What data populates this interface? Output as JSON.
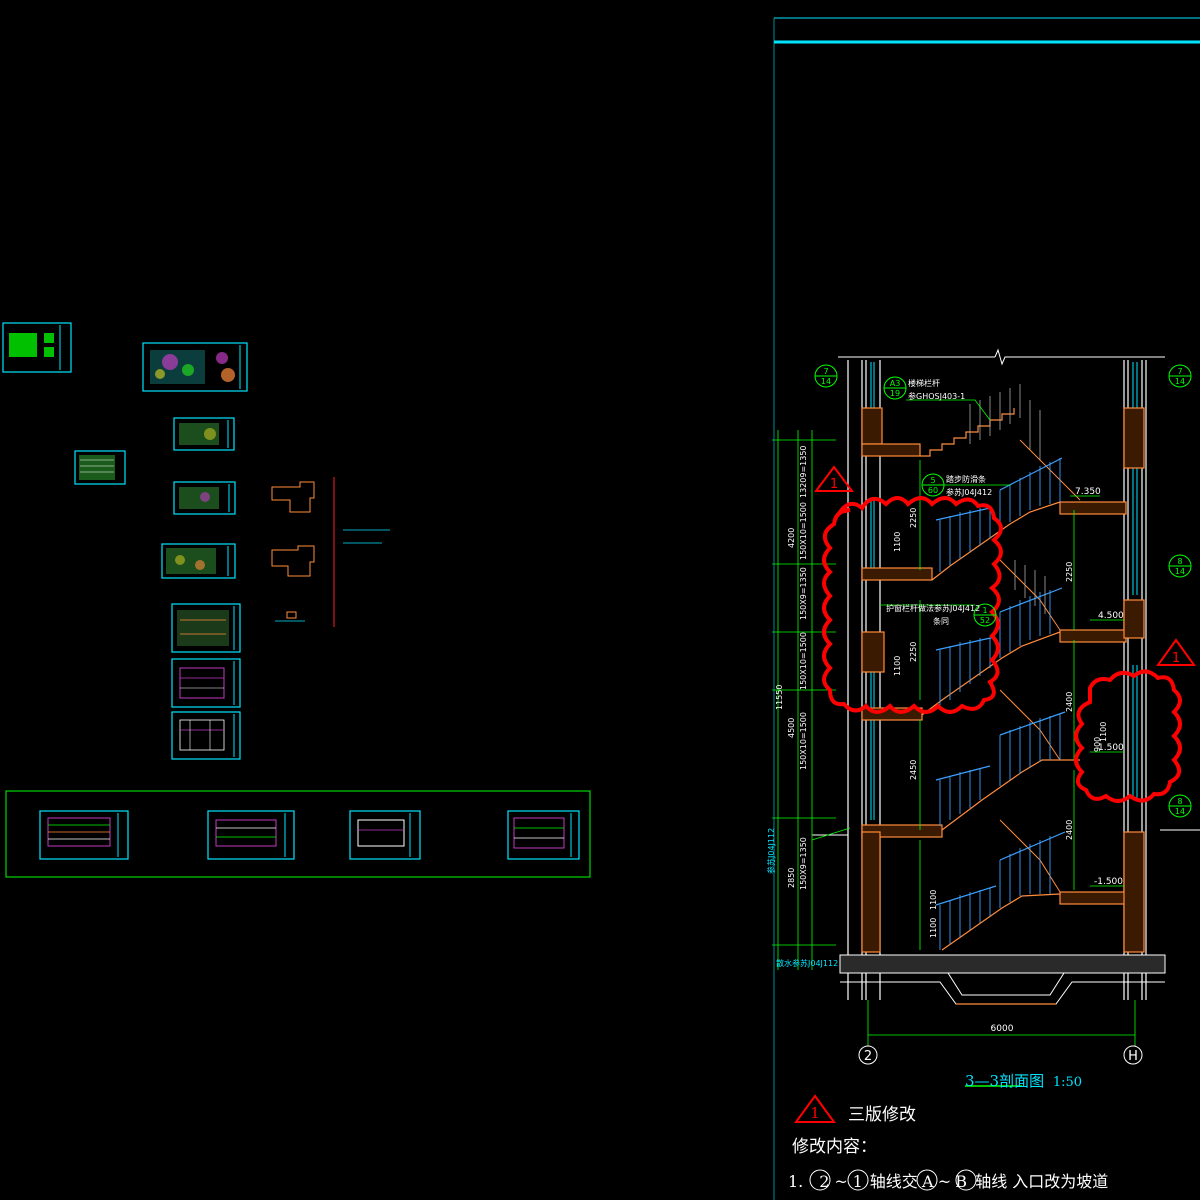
{
  "drawing": {
    "section_title": "3—3剖面图",
    "section_scale": "1:50",
    "axes": {
      "left": "2",
      "right": "H"
    },
    "dimension_bottom": "6000",
    "elevations": [
      "7.350",
      "4.500",
      "1.500",
      "-1.500"
    ],
    "left_dims": [
      "4200",
      "4500",
      "11550",
      "2850",
      "13209=1350",
      "150X10=1500",
      "150X9=1350",
      "150X10=1500",
      "150X10=1500",
      "150X9=1350"
    ],
    "inner_dims": [
      "2250",
      "1100",
      "2250",
      "1100",
      "2450",
      "2400",
      "2400",
      "1100",
      "2250",
      "900",
      "1100"
    ],
    "detail_marks": [
      {
        "num": "7",
        "sheet": "14"
      },
      {
        "num": "7",
        "sheet": "14"
      },
      {
        "num": "8",
        "sheet": "14"
      },
      {
        "num": "8",
        "sheet": "14"
      },
      {
        "num": "5",
        "sheet": "60"
      },
      {
        "num": "A3",
        "sheet": "19"
      },
      {
        "num": "1",
        "sheet": "52"
      }
    ],
    "annotations": [
      "楼梯栏杆",
      "参GHOSJ403-1",
      "踏步防滑条",
      "参苏J04J412",
      "护窗栏杆做法参苏J04J412",
      "条同",
      "参苏J04J112",
      "散水参苏J04J112"
    ],
    "revision_symbol": "1"
  },
  "revision": {
    "symbol": "1",
    "label": "三版修改",
    "content_label": "修改内容：",
    "item_prefix": "1.",
    "item_axis_a": "2",
    "item_tilde1": "~",
    "item_axis_b": "1",
    "item_text1": "轴线交",
    "item_axis_c": "A",
    "item_tilde2": "~",
    "item_axis_d": "B",
    "item_text2": "轴线 入口改为坡道"
  },
  "colors": {
    "background": "#000000",
    "cyan": "#00e5ff",
    "green": "#00ff00",
    "red": "#ff0000",
    "orange": "#ff8c3c",
    "white": "#ffffff",
    "blue_hatch": "#3aa0ff"
  }
}
